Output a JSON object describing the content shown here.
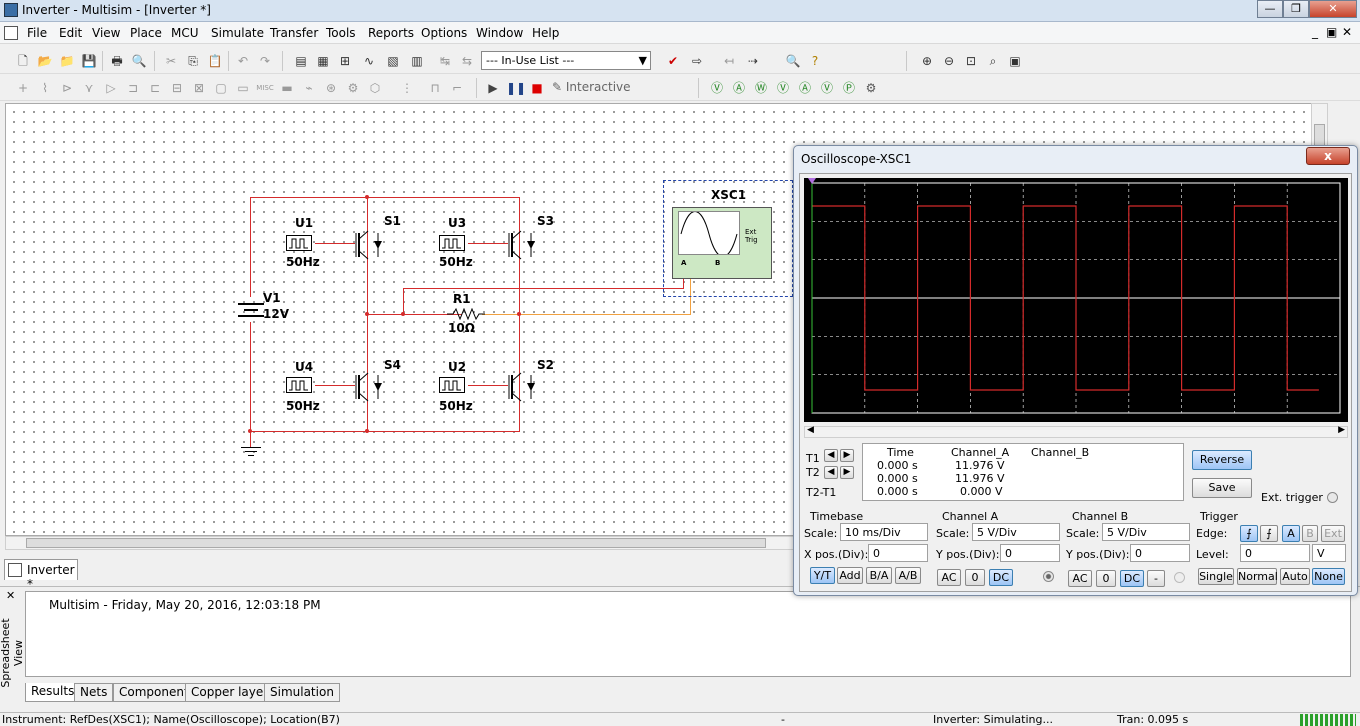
{
  "window": {
    "title": "Inverter - Multisim - [Inverter *]"
  },
  "menu": [
    "File",
    "Edit",
    "View",
    "Place",
    "MCU",
    "Simulate",
    "Transfer",
    "Tools",
    "Reports",
    "Options",
    "Window",
    "Help"
  ],
  "toolbar": {
    "inuse_list": "--- In-Use List ---",
    "interactive": "Interactive"
  },
  "circuit": {
    "sources": [
      {
        "ref": "U1",
        "freq": "50Hz"
      },
      {
        "ref": "U3",
        "freq": "50Hz"
      },
      {
        "ref": "U4",
        "freq": "50Hz"
      },
      {
        "ref": "U2",
        "freq": "50Hz"
      }
    ],
    "switches": [
      "S1",
      "S3",
      "S4",
      "S2"
    ],
    "battery": {
      "ref": "V1",
      "value": "12V"
    },
    "resistor": {
      "ref": "R1",
      "value": "10Ω"
    },
    "scope": {
      "ref": "XSC1",
      "ext_trig": "Ext Trig",
      "ch_a": "A",
      "ch_b": "B"
    }
  },
  "doc_tab": "Inverter *",
  "spreadsheet": {
    "side_label": "Spreadsheet View",
    "log": "Multisim  -  Friday, May 20, 2016, 12:03:18 PM",
    "tabs": [
      "Results",
      "Nets",
      "Components",
      "Copper layers",
      "Simulation"
    ]
  },
  "status": {
    "instrument": "Instrument: RefDes(XSC1); Name(Oscilloscope); Location(B7)",
    "dash": "-",
    "state": "Inverter: Simulating...",
    "tran": "Tran: 0.095 s"
  },
  "oscilloscope": {
    "title": "Oscilloscope-XSC1",
    "close": "x",
    "readout": {
      "headers": [
        "Time",
        "Channel_A",
        "Channel_B"
      ],
      "rows": [
        {
          "label": "T1",
          "time": "0.000 s",
          "a": "11.976 V"
        },
        {
          "label": "T2",
          "time": "0.000 s",
          "a": "11.976 V"
        },
        {
          "label": "T2-T1",
          "time": "0.000 s",
          "a": "0.000 V"
        }
      ]
    },
    "buttons": {
      "reverse": "Reverse",
      "save": "Save",
      "ext_trigger": "Ext. trigger"
    },
    "timebase": {
      "title": "Timebase",
      "scale_label": "Scale:",
      "scale": "10 ms/Div",
      "xpos_label": "X pos.(Div):",
      "xpos": "0",
      "modes": [
        "Y/T",
        "Add",
        "B/A",
        "A/B"
      ]
    },
    "channel_a": {
      "title": "Channel A",
      "scale_label": "Scale:",
      "scale": "5  V/Div",
      "ypos_label": "Y pos.(Div):",
      "ypos": "0",
      "coupling": [
        "AC",
        "0",
        "DC"
      ]
    },
    "channel_b": {
      "title": "Channel B",
      "scale_label": "Scale:",
      "scale": "5  V/Div",
      "ypos_label": "Y pos.(Div):",
      "ypos": "0",
      "coupling": [
        "AC",
        "0",
        "DC",
        "-"
      ]
    },
    "trigger": {
      "title": "Trigger",
      "edge_label": "Edge:",
      "level_label": "Level:",
      "level": "0",
      "level_unit": "V",
      "edge_src": [
        "A",
        "B",
        "Ext"
      ],
      "modes": [
        "Single",
        "Normal",
        "Auto",
        "None"
      ]
    },
    "waveform": {
      "timebase_ms_per_div": 10,
      "volts_per_div": 5,
      "amplitude_v": 12,
      "frequency_hz": 50
    }
  }
}
